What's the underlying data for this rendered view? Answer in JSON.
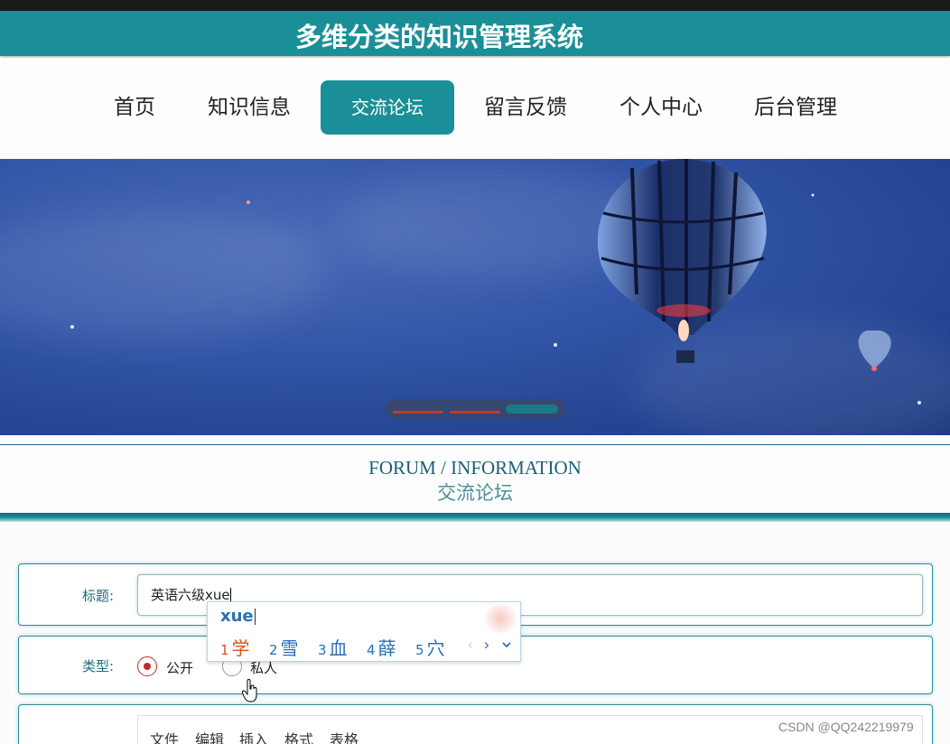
{
  "site": {
    "title": "多维分类的知识管理系统"
  },
  "nav": {
    "items": [
      {
        "label": "首页",
        "active": false
      },
      {
        "label": "知识信息",
        "active": false
      },
      {
        "label": "交流论坛",
        "active": true
      },
      {
        "label": "留言反馈",
        "active": false
      },
      {
        "label": "个人中心",
        "active": false
      },
      {
        "label": "后台管理",
        "active": false
      }
    ],
    "accent_color": "#1b8f98"
  },
  "carousel": {
    "slides": 3,
    "active_index": 2
  },
  "section": {
    "title_en": "FORUM / INFORMATION",
    "title_cn": "交流论坛"
  },
  "form": {
    "title_label": "标题:",
    "title_value": "英语六级xue",
    "type_label": "类型:",
    "type_options": [
      {
        "label": "公开",
        "checked": true
      },
      {
        "label": "私人",
        "checked": false
      }
    ],
    "editor_menu": [
      "文件",
      "编辑",
      "插入",
      "格式",
      "表格"
    ]
  },
  "ime": {
    "composition": "xue",
    "candidates": [
      {
        "num": "1",
        "text": "学"
      },
      {
        "num": "2",
        "text": "雪"
      },
      {
        "num": "3",
        "text": "血"
      },
      {
        "num": "4",
        "text": "薛"
      },
      {
        "num": "5",
        "text": "穴"
      }
    ],
    "icons": [
      "chevron-left-icon",
      "chevron-right-icon",
      "chevron-down-icon"
    ]
  },
  "watermark": "CSDN @QQ242219979"
}
